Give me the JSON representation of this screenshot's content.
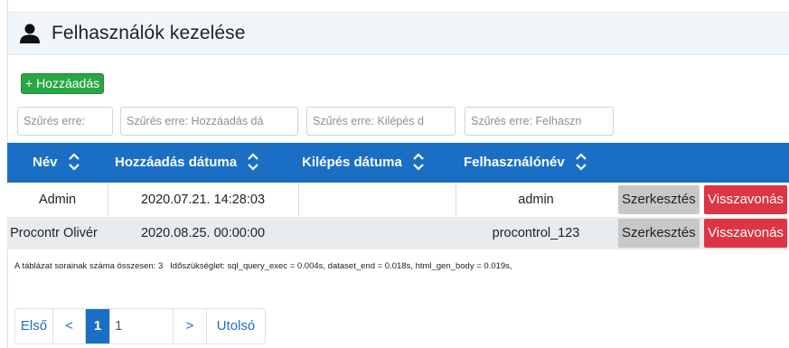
{
  "header": {
    "title": "Felhasználók kezelése",
    "icon": "user-icon"
  },
  "toolbar": {
    "add_label": "+ Hozzáadás"
  },
  "filters": [
    "Szűrés erre:",
    "Szűrés erre: Hozzáadás dá",
    "Szűrés erre: Kilépés d",
    "Szűrés erre: Felhaszn"
  ],
  "table": {
    "columns": [
      "Név",
      "Hozzáadás dátuma",
      "Kilépés dátuma",
      "Felhasználónév"
    ],
    "rows": [
      {
        "name": "Admin",
        "added": "2020.07.21. 14:28:03",
        "left": "",
        "username": "admin",
        "edit": "Szerkesztés",
        "revoke": "Visszavonás"
      },
      {
        "name": "Procontr Olivér",
        "added": "2020.08.25. 00:00:00",
        "left": "",
        "username": "procontrol_123",
        "edit": "Szerkesztés",
        "revoke": "Visszavonás"
      }
    ]
  },
  "summary": "A táblázat sorainak száma összesen: 3   Időszükséglet: sql_query_exec = 0.004s, dataset_end = 0.018s, html_gen_body = 0.019s,",
  "pagination": {
    "first": "Első",
    "prev": "<",
    "current": "1",
    "page_input": "1",
    "next": ">",
    "last": "Utolsó"
  },
  "colors": {
    "header_bg": "#1a6fc4",
    "add_button": "#28a745",
    "revoke_button": "#dc3545",
    "edit_button": "#c8c8c8"
  }
}
